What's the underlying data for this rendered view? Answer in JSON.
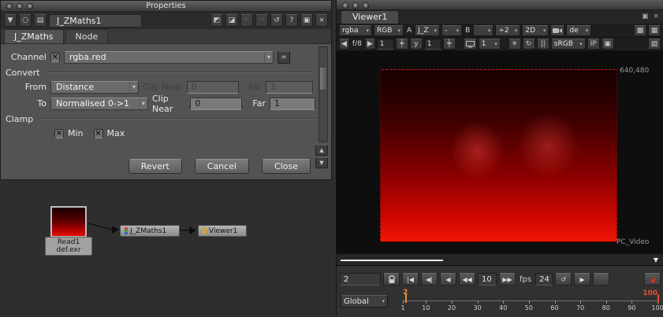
{
  "ui": {
    "chevron_down": "▾",
    "check_mark": "×",
    "disclosure": "▼",
    "snapshot": "○",
    "save": "▤",
    "swatch_a": "◩",
    "swatch_b": "◪",
    "undo": "↶",
    "redo": "↷",
    "revert": "↺",
    "help": "?",
    "float": "▣",
    "close": "×",
    "scroll_up": "▲",
    "scroll_down": "▼",
    "slider": "╪",
    "gear": "✳",
    "refresh": "↻",
    "pause": "||",
    "checker": "▩",
    "expand": "▦",
    "grid": "▣",
    "stripes": "▨",
    "tri_down": "▼",
    "arrow_left": "◀",
    "arrow_right": "▶"
  },
  "properties": {
    "window_title": "Properties",
    "node_name": "J_ZMaths1",
    "tabs": [
      {
        "label": "J_ZMaths"
      },
      {
        "label": "Node"
      }
    ],
    "channel": {
      "label": "Channel",
      "value": "rgba.red",
      "equals_button": "="
    },
    "convert": {
      "group_label": "Convert",
      "from_label": "From",
      "from_value": "Distance",
      "from_near_label": "Clip Near",
      "from_near_value": "0",
      "from_far_label": "Far",
      "from_far_value": "1",
      "to_label": "To",
      "to_value": "Normalised 0->1",
      "to_near_label": "Clip Near",
      "to_near_value": "0",
      "to_far_label": "Far",
      "to_far_value": "1"
    },
    "clamp": {
      "group_label": "Clamp",
      "min_label": "Min",
      "max_label": "Max"
    },
    "buttons": [
      {
        "label": "Revert"
      },
      {
        "label": "Cancel"
      },
      {
        "label": "Close"
      }
    ]
  },
  "node_graph": {
    "read_node_name": "Read1",
    "read_node_file": "def.exr",
    "zmaths_node_label": "J_ZMaths1",
    "viewer_node_label": "Viewer1"
  },
  "viewer": {
    "tab_label": "Viewer1",
    "toolbar1": {
      "channels": "rgba",
      "display": "RGB",
      "a_label": "A",
      "a_input": "J_Z",
      "wipe": "-",
      "b_label": "B",
      "b_input": "",
      "proxy": "÷2",
      "view": "2D",
      "lut_group": "de"
    },
    "toolbar2": {
      "gain_label": "f/8",
      "gain_value": "1",
      "gamma_label": "y",
      "gamma_value": "1",
      "downrez": "1",
      "lut": "sRGB",
      "input_process": "IP"
    },
    "canvas": {
      "resolution": "640,480",
      "format_name": "PC_Video"
    },
    "transport": {
      "frame": "2",
      "goto_start": "|◀",
      "prev_keyframe": "◀|",
      "play_backward": "◀",
      "step_back": "◀◀",
      "increment": "10",
      "step_forward": "▶▶",
      "fps_label": "fps",
      "fps_value": "24",
      "play_forward": "▶"
    },
    "timeline": {
      "range_mode": "Global",
      "current_frame": "2",
      "end_frame": "100",
      "ticks": [
        "1",
        "10",
        "20",
        "30",
        "40",
        "50",
        "60",
        "70",
        "80",
        "90",
        "100"
      ]
    }
  }
}
